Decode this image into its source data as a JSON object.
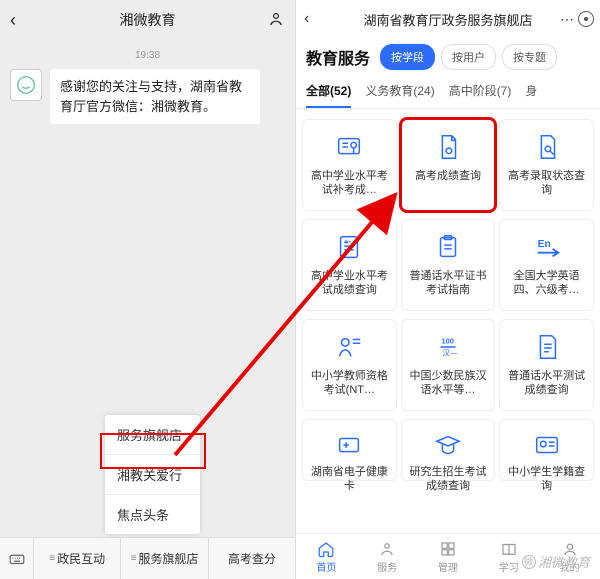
{
  "left": {
    "title": "湘微教育",
    "time": "19:38",
    "message": "感谢您的关注与支持，湖南省教育厅官方微信：湘微教育。",
    "popup": [
      "服务旗舰店",
      "湘教关爱行",
      "焦点头条"
    ],
    "bottom_tabs": [
      "政民互动",
      "服务旗舰店",
      "高考查分"
    ]
  },
  "right": {
    "title": "湖南省教育厅政务服务旗舰店",
    "section": "教育服务",
    "filters": {
      "f1": "按学段",
      "f2": "按用户",
      "f3": "按专题"
    },
    "categories": [
      {
        "label": "全部(52)",
        "active": true
      },
      {
        "label": "义务教育(24)"
      },
      {
        "label": "高中阶段(7)"
      }
    ],
    "cat_more": "身",
    "cards": [
      {
        "label": "高中学业水平考试补考成…"
      },
      {
        "label": "高考成绩查询"
      },
      {
        "label": "高考录取状态查询"
      },
      {
        "label": "高中学业水平考试成绩查询"
      },
      {
        "label": "普通话水平证书考试指南"
      },
      {
        "label": "全国大学英语四、六级考…"
      },
      {
        "label": "中小学教师资格考试(NT…"
      },
      {
        "label": "中国少数民族汉语水平等…"
      },
      {
        "label": "普通话水平测试成绩查询"
      },
      {
        "label": "湖南省电子健康卡"
      },
      {
        "label": "研究生招生考试成绩查询"
      },
      {
        "label": "中小学生学籍查询"
      }
    ],
    "bottom": {
      "t1": "首页",
      "t2": "服务",
      "t3": "管理",
      "t4": "学习",
      "t5": "我的"
    },
    "watermark": "湘微教育"
  }
}
